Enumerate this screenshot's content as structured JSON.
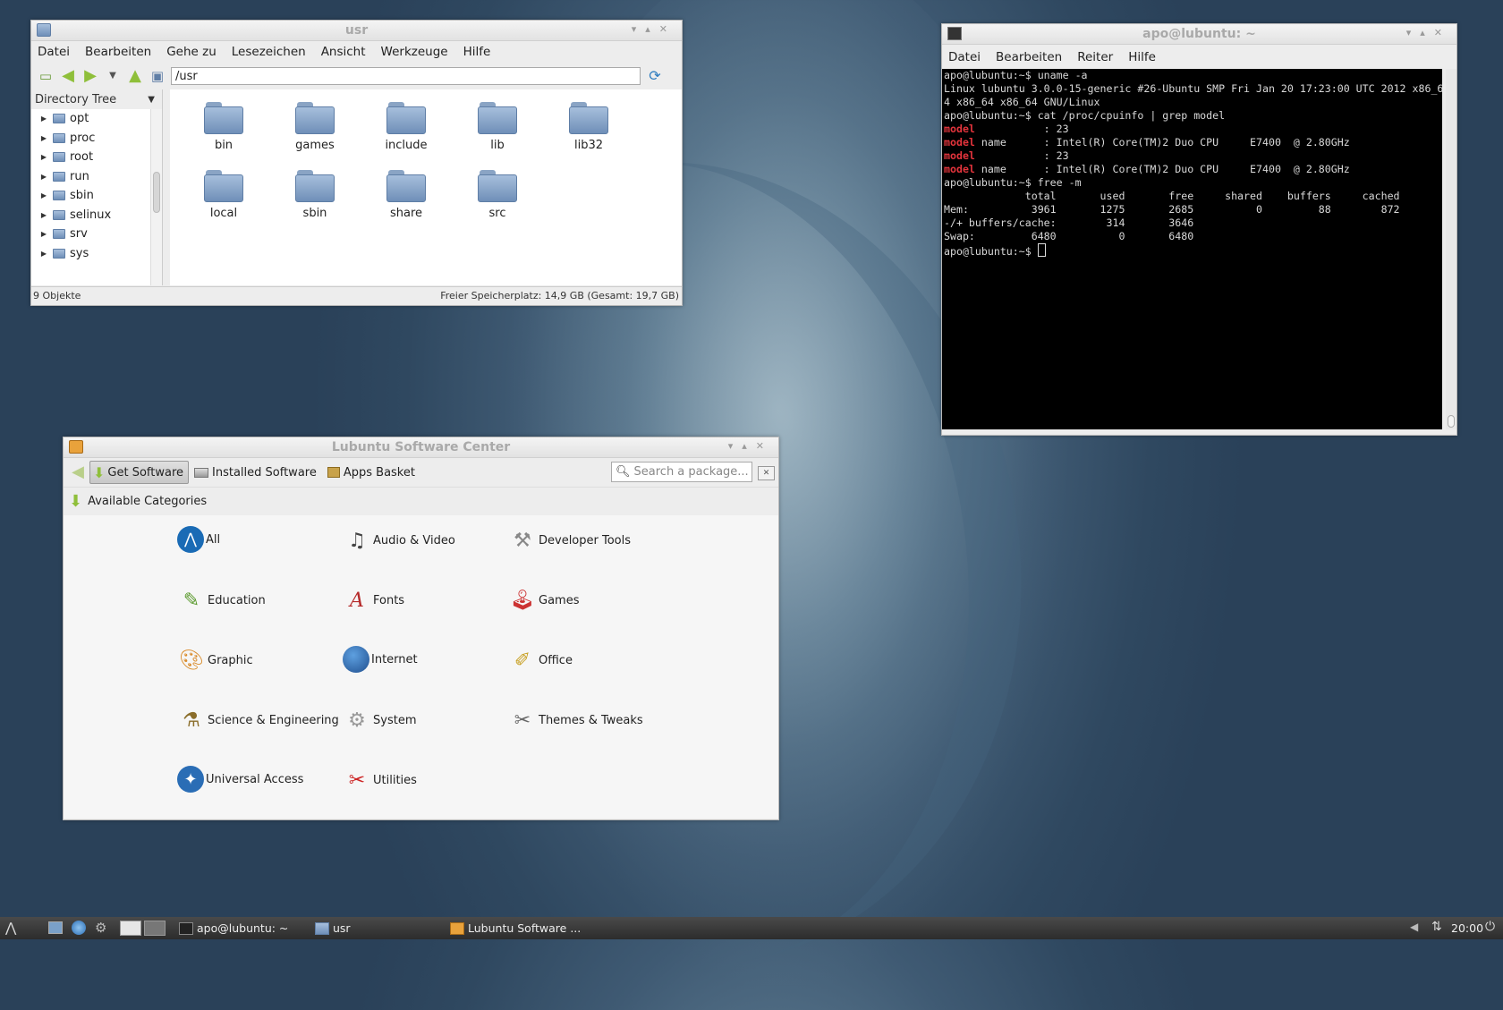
{
  "file_manager": {
    "title": "usr",
    "menu": [
      "Datei",
      "Bearbeiten",
      "Gehe zu",
      "Lesezeichen",
      "Ansicht",
      "Werkzeuge",
      "Hilfe"
    ],
    "path": "/usr",
    "sidebar_title": "Directory Tree",
    "tree": [
      "opt",
      "proc",
      "root",
      "run",
      "sbin",
      "selinux",
      "srv",
      "sys"
    ],
    "files": [
      "bin",
      "games",
      "include",
      "lib",
      "lib32",
      "local",
      "sbin",
      "share",
      "src"
    ],
    "status_left": "9 Objekte",
    "status_right": "Freier Speicherplatz: 14,9 GB (Gesamt: 19,7 GB)"
  },
  "terminal": {
    "title": "apo@lubuntu: ~",
    "menu": [
      "Datei",
      "Bearbeiten",
      "Reiter",
      "Hilfe"
    ],
    "lines": [
      {
        "prefix": "",
        "text": "apo@lubuntu:~$ uname -a"
      },
      {
        "prefix": "",
        "text": "Linux lubuntu 3.0.0-15-generic #26-Ubuntu SMP Fri Jan 20 17:23:00 UTC 2012 x86_6"
      },
      {
        "prefix": "",
        "text": "4 x86_64 x86_64 GNU/Linux"
      },
      {
        "prefix": "",
        "text": "apo@lubuntu:~$ cat /proc/cpuinfo | grep model"
      },
      {
        "prefix": "model",
        "text": "           : 23"
      },
      {
        "prefix": "model",
        "text": " name      : Intel(R) Core(TM)2 Duo CPU     E7400  @ 2.80GHz"
      },
      {
        "prefix": "model",
        "text": "           : 23"
      },
      {
        "prefix": "model",
        "text": " name      : Intel(R) Core(TM)2 Duo CPU     E7400  @ 2.80GHz"
      },
      {
        "prefix": "",
        "text": "apo@lubuntu:~$ free -m"
      },
      {
        "prefix": "",
        "text": "             total       used       free     shared    buffers     cached"
      },
      {
        "prefix": "",
        "text": "Mem:          3961       1275       2685          0         88        872"
      },
      {
        "prefix": "",
        "text": "-/+ buffers/cache:        314       3646"
      },
      {
        "prefix": "",
        "text": "Swap:         6480          0       6480"
      },
      {
        "prefix": "",
        "text": "apo@lubuntu:~$ "
      }
    ]
  },
  "software_center": {
    "title": "Lubuntu Software Center",
    "get_software": "Get Software",
    "installed_software": "Installed Software",
    "apps_basket": "Apps Basket",
    "search_placeholder": "Search a package...",
    "section_title": "Available Categories",
    "categories": [
      {
        "label": "All",
        "icon": "lubuntu-logo-icon"
      },
      {
        "label": "Audio & Video",
        "icon": "audio-video-icon"
      },
      {
        "label": "Developer Tools",
        "icon": "developer-tools-icon"
      },
      {
        "label": "Education",
        "icon": "education-icon"
      },
      {
        "label": "Fonts",
        "icon": "fonts-icon"
      },
      {
        "label": "Games",
        "icon": "joystick-icon"
      },
      {
        "label": "Graphic",
        "icon": "palette-icon"
      },
      {
        "label": "Internet",
        "icon": "globe-icon"
      },
      {
        "label": "Office",
        "icon": "office-icon"
      },
      {
        "label": "Science & Engineering",
        "icon": "science-icon"
      },
      {
        "label": "System",
        "icon": "gear-icon"
      },
      {
        "label": "Themes & Tweaks",
        "icon": "themes-icon"
      },
      {
        "label": "Universal Access",
        "icon": "accessibility-icon"
      },
      {
        "label": "Utilities",
        "icon": "utilities-icon"
      }
    ]
  },
  "taskbar": {
    "tasks": [
      "apo@lubuntu: ~",
      "usr",
      "Lubuntu Software ..."
    ],
    "clock": "20:00"
  },
  "colors": {
    "terminal_bg": "#000000",
    "terminal_highlight": "#e4343c",
    "desktop": "#3f5a73"
  }
}
